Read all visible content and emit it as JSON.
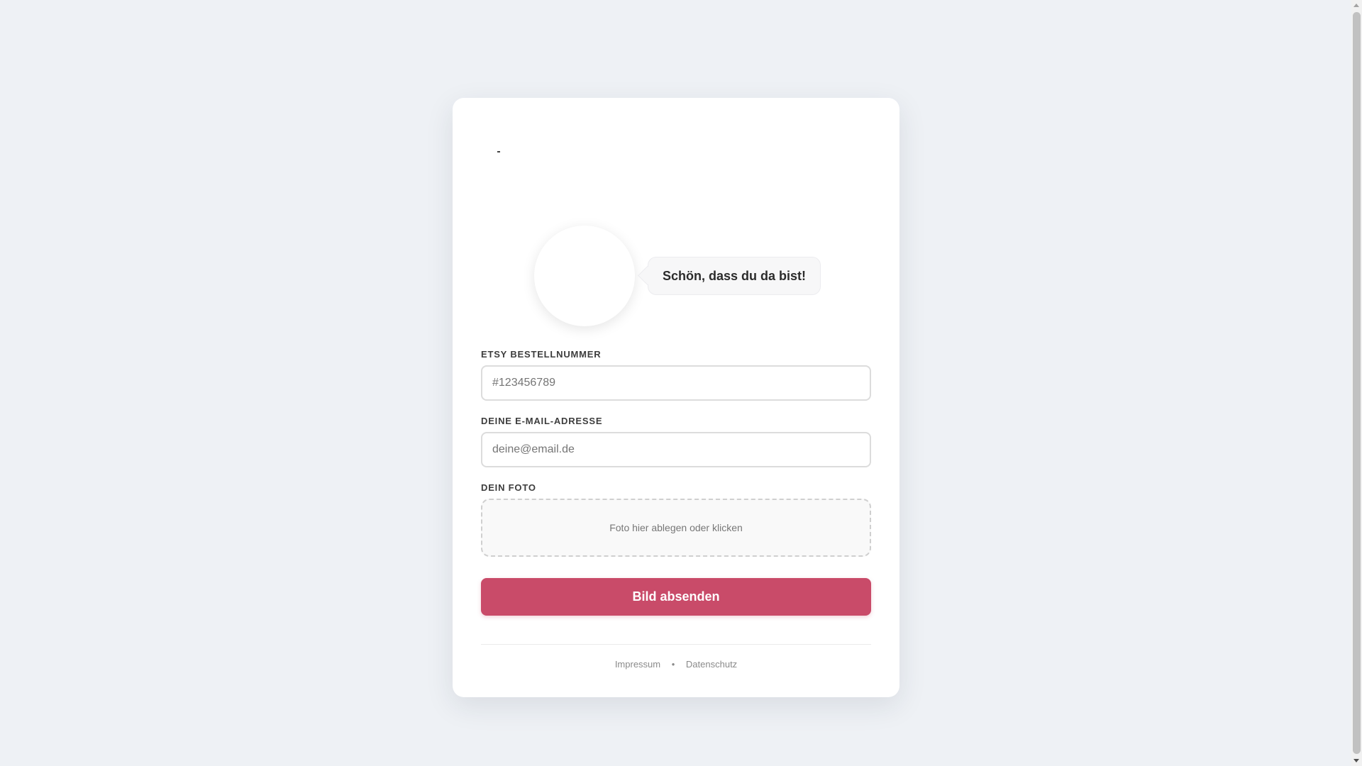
{
  "hero": {
    "greeting": "Schön, dass du da bist!"
  },
  "form": {
    "order_label": "ETSY BESTELLNUMMER",
    "order_placeholder": "#123456789",
    "email_label": "DEINE E-MAIL-ADRESSE",
    "email_placeholder": "deine@email.de",
    "photo_label": "DEIN FOTO",
    "dropzone_text": "Foto hier ablegen oder klicken",
    "submit_label": "Bild absenden"
  },
  "footer": {
    "imprint": "Impressum",
    "separator": "•",
    "privacy": "Datenschutz"
  },
  "colors": {
    "background": "#eef1f5",
    "accent": "#c94b69",
    "card": "#ffffff"
  }
}
